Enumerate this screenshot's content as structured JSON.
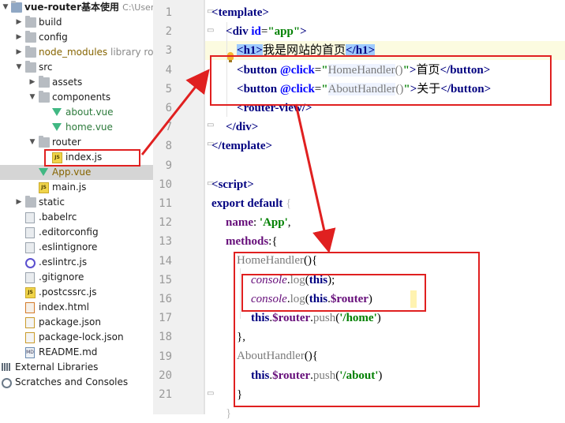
{
  "project": {
    "name": "vue-router基本使用",
    "path": "C:\\Users\\z"
  },
  "tree": [
    {
      "key": "build",
      "label": "build",
      "type": "folder",
      "indent": 1,
      "arrow": "right"
    },
    {
      "key": "config",
      "label": "config",
      "type": "folder",
      "indent": 1,
      "arrow": "right"
    },
    {
      "key": "node_modules",
      "label": "node_modules",
      "sub": "library root",
      "type": "folder",
      "indent": 1,
      "arrow": "right",
      "mod": true
    },
    {
      "key": "src",
      "label": "src",
      "type": "folder",
      "indent": 1,
      "arrow": "down"
    },
    {
      "key": "assets",
      "label": "assets",
      "type": "folder",
      "indent": 2,
      "arrow": "right"
    },
    {
      "key": "components",
      "label": "components",
      "type": "folder",
      "indent": 2,
      "arrow": "down"
    },
    {
      "key": "about-vue",
      "label": "about.vue",
      "type": "vue",
      "indent": 3
    },
    {
      "key": "home-vue",
      "label": "home.vue",
      "type": "vue",
      "indent": 3
    },
    {
      "key": "router",
      "label": "router",
      "type": "folder",
      "indent": 2,
      "arrow": "down"
    },
    {
      "key": "index-js",
      "label": "index.js",
      "type": "js",
      "indent": 3
    },
    {
      "key": "app-vue",
      "label": "App.vue",
      "type": "vue",
      "indent": 2,
      "selected": true,
      "mod": true
    },
    {
      "key": "main-js",
      "label": "main.js",
      "type": "js",
      "indent": 2
    },
    {
      "key": "static",
      "label": "static",
      "type": "folder",
      "indent": 1,
      "arrow": "right"
    },
    {
      "key": "babelrc",
      "label": ".babelrc",
      "type": "file",
      "indent": 1
    },
    {
      "key": "editorconfig",
      "label": ".editorconfig",
      "type": "file",
      "indent": 1
    },
    {
      "key": "eslintignore",
      "label": ".eslintignore",
      "type": "file",
      "indent": 1
    },
    {
      "key": "eslintrc",
      "label": ".eslintrc.js",
      "type": "eslint",
      "indent": 1
    },
    {
      "key": "gitignore",
      "label": ".gitignore",
      "type": "file",
      "indent": 1
    },
    {
      "key": "postcssrc",
      "label": ".postcssrc.js",
      "type": "js",
      "indent": 1
    },
    {
      "key": "index-html",
      "label": "index.html",
      "type": "html",
      "indent": 1
    },
    {
      "key": "package-json",
      "label": "package.json",
      "type": "json",
      "indent": 1
    },
    {
      "key": "package-lock",
      "label": "package-lock.json",
      "type": "json",
      "indent": 1
    },
    {
      "key": "readme",
      "label": "README.md",
      "type": "md",
      "indent": 1
    },
    {
      "key": "ext-libs",
      "label": "External Libraries",
      "type": "lib",
      "indent": 0
    },
    {
      "key": "scratches",
      "label": "Scratches and Consoles",
      "type": "scratch",
      "indent": 0
    }
  ],
  "line_numbers": [
    "1",
    "2",
    "3",
    "4",
    "5",
    "6",
    "7",
    "8",
    "9",
    "10",
    "11",
    "12",
    "13",
    "14",
    "15",
    "16",
    "17",
    "18",
    "19",
    "20",
    "21"
  ],
  "code": {
    "l1_tag": "template",
    "l2_div": "div",
    "l2_attr": "id",
    "l2_val": "\"app\"",
    "l3_h1_open": "h1",
    "l3_text": "我是网站的首页",
    "l3_h1_close": "/h1",
    "l4_button": "button",
    "l4_attr": "@click",
    "l4_val_q": "\"",
    "l4_handler": "HomeHandler",
    "l4_parens": "()",
    "l4_text": "首页",
    "l4_close": "/button",
    "l5_button": "button",
    "l5_attr": "@click",
    "l5_val_q": "\"",
    "l5_handler": "AboutHandler",
    "l5_parens": "()",
    "l5_text": "关于",
    "l5_close": "/button",
    "l6_tag": "router-view/",
    "l7_tag": "/div",
    "l8_tag": "/template",
    "l10_tag": "script",
    "l11_export": "export",
    "l11_default": "default",
    "l11_brace": "{",
    "l12_key": "name",
    "l12_val": "'App'",
    "l13_key": "methods",
    "l13_rest": ":{",
    "l14_fn": "HomeHandler",
    "l14_rest": "(){",
    "l15_obj": "console",
    "l15_m": "log",
    "l15_arg": "this",
    "l16_obj": "console",
    "l16_m": "log",
    "l16_this": "this",
    "l16_prop": "$router",
    "l17_this": "this",
    "l17_prop": "$router",
    "l17_m": "push",
    "l17_arg": "'/home'",
    "l18": "},",
    "l19_fn": "AboutHandler",
    "l19_rest": "(){",
    "l20_this": "this",
    "l20_prop": "$router",
    "l20_m": "push",
    "l20_arg": "'/about'",
    "l21": "}"
  }
}
